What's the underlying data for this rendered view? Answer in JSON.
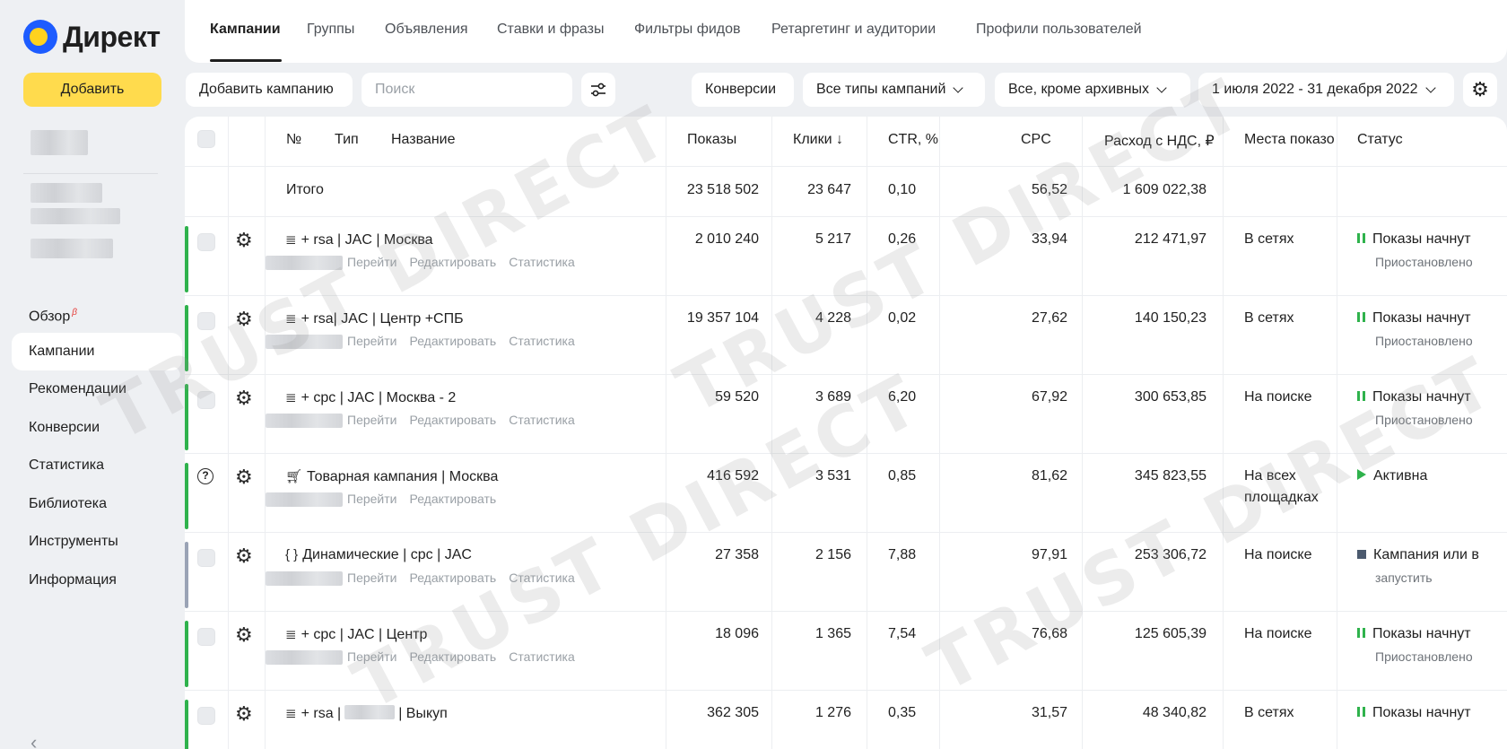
{
  "app": {
    "logo_text": "Директ",
    "add_button": "Добавить"
  },
  "sidebar": {
    "nav": [
      {
        "label": "Обзор",
        "badge": "β"
      },
      {
        "label": "Кампании",
        "active": true
      },
      {
        "label": "Рекомендации"
      },
      {
        "label": "Конверсии"
      },
      {
        "label": "Статистика"
      },
      {
        "label": "Библиотека"
      },
      {
        "label": "Инструменты"
      },
      {
        "label": "Информация"
      }
    ],
    "collapse_glyph": "‹"
  },
  "tabs": [
    {
      "label": "Кампании",
      "active": true
    },
    {
      "label": "Группы"
    },
    {
      "label": "Объявления"
    },
    {
      "label": "Ставки и фразы"
    },
    {
      "label": "Фильтры фидов"
    },
    {
      "label": "Ретаргетинг и аудитории"
    },
    {
      "label": "Профили пользователей"
    }
  ],
  "toolbar": {
    "add_campaign": "Добавить кампанию",
    "search_placeholder": "Поиск",
    "conversions": "Конверсии",
    "campaign_types": "Все типы кампаний",
    "archive_filter": "Все, кроме архивных",
    "date_range": "1 июля 2022 - 31 декабря 2022"
  },
  "table": {
    "headers": {
      "no": "№",
      "type": "Тип",
      "name": "Название",
      "impressions": "Показы",
      "clicks": "Клики ↓",
      "ctr": "CTR, %",
      "cpc": "CPC",
      "spend": "Расход с НДС, ₽",
      "placements": "Места показо",
      "status": "Статус"
    },
    "total": {
      "label": "Итого",
      "impressions": "23 518 502",
      "clicks": "23 647",
      "ctr": "0,10",
      "cpc": "56,52",
      "spend": "1 609 022,38"
    },
    "rows": [
      {
        "icon": "text-ad",
        "name": "+ rsa | JAC | Москва",
        "impressions": "2 010 240",
        "clicks": "5 217",
        "ctr": "0,26",
        "cpc": "33,94",
        "spend": "212 471,97",
        "placement": "В сетях",
        "status": "Показы начнут",
        "status_sub": "Приостановлено",
        "status_icon": "pause",
        "accent": "#2fb24c",
        "links": [
          "Перейти",
          "Редактировать",
          "Статистика"
        ]
      },
      {
        "icon": "text-ad",
        "name": "+ rsa| JAC | Центр +СПБ",
        "impressions": "19 357 104",
        "clicks": "4 228",
        "ctr": "0,02",
        "cpc": "27,62",
        "spend": "140 150,23",
        "placement": "В сетях",
        "status": "Показы начнут",
        "status_sub": "Приостановлено",
        "status_icon": "pause",
        "accent": "#2fb24c",
        "links": [
          "Перейти",
          "Редактировать",
          "Статистика"
        ]
      },
      {
        "icon": "text-ad",
        "name": "+ cpc | JAC | Москва - 2",
        "impressions": "59 520",
        "clicks": "3 689",
        "ctr": "6,20",
        "cpc": "67,92",
        "spend": "300 653,85",
        "placement": "На поиске",
        "status": "Показы начнут",
        "status_sub": "Приостановлено",
        "status_icon": "pause",
        "accent": "#2fb24c",
        "links": [
          "Перейти",
          "Редактировать",
          "Статистика"
        ]
      },
      {
        "icon": "cart",
        "name": "Товарная кампания | Москва",
        "impressions": "416 592",
        "clicks": "3 531",
        "ctr": "0,85",
        "cpc": "81,62",
        "spend": "345 823,55",
        "placement": "На всех",
        "placement2": "площадках",
        "status": "Активна",
        "status_sub": "",
        "status_icon": "play",
        "accent": "#2fb24c",
        "help": true,
        "links": [
          "Перейти",
          "Редактировать"
        ]
      },
      {
        "icon": "braces",
        "name": "Динамические | cpc | JAC",
        "impressions": "27 358",
        "clicks": "2 156",
        "ctr": "7,88",
        "cpc": "97,91",
        "spend": "253 306,72",
        "placement": "На поиске",
        "status": "Кампания или в",
        "status_sub": "запустить",
        "status_icon": "stop",
        "accent": "#9aa3b5",
        "links": [
          "Перейти",
          "Редактировать",
          "Статистика"
        ]
      },
      {
        "icon": "text-ad",
        "name": "+ cpc | JAC | Центр",
        "impressions": "18 096",
        "clicks": "1 365",
        "ctr": "7,54",
        "cpc": "76,68",
        "spend": "125 605,39",
        "placement": "На поиске",
        "status": "Показы начнут",
        "status_sub": "Приостановлено",
        "status_icon": "pause",
        "accent": "#2fb24c",
        "links": [
          "Перейти",
          "Редактировать",
          "Статистика"
        ]
      },
      {
        "icon": "text-ad",
        "name": "+ rsa |",
        "name_suffix": "| Выкуп",
        "impressions": "362 305",
        "clicks": "1 276",
        "ctr": "0,35",
        "cpc": "31,57",
        "spend": "48 340,82",
        "placement": "В сетях",
        "status": "Показы начнут",
        "status_sub": "",
        "status_icon": "pause",
        "accent": "#2fb24c",
        "links": []
      }
    ]
  },
  "watermark_text": "TRUST DIRECT",
  "colors": {
    "accent_yellow": "#ffdb4d",
    "brand_blue": "#1d5cff",
    "active_green": "#2fb24c",
    "stopped_gray": "#4b5a6e"
  }
}
